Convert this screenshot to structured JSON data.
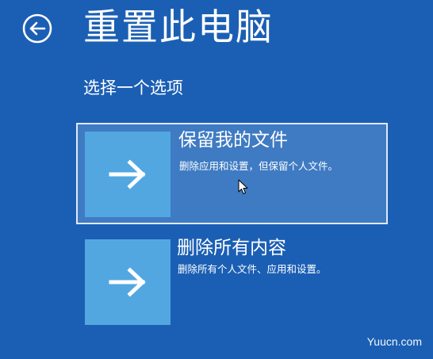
{
  "header": {
    "title": "重置此电脑",
    "back_icon": "back-arrow-circle-icon"
  },
  "subtitle": "选择一个选项",
  "options": [
    {
      "title": "保留我的文件",
      "description": "删除应用和设置，但保留个人文件。",
      "icon": "arrow-right-icon",
      "selected": true
    },
    {
      "title": "删除所有内容",
      "description": "删除所有个人文件、应用和设置。",
      "icon": "arrow-right-icon",
      "selected": false
    }
  ],
  "colors": {
    "background": "#1b5fb4",
    "selected_option": "#3f7bc3",
    "tile": "#52a7e1",
    "text": "#ffffff"
  },
  "watermark": "Yuucn.com"
}
